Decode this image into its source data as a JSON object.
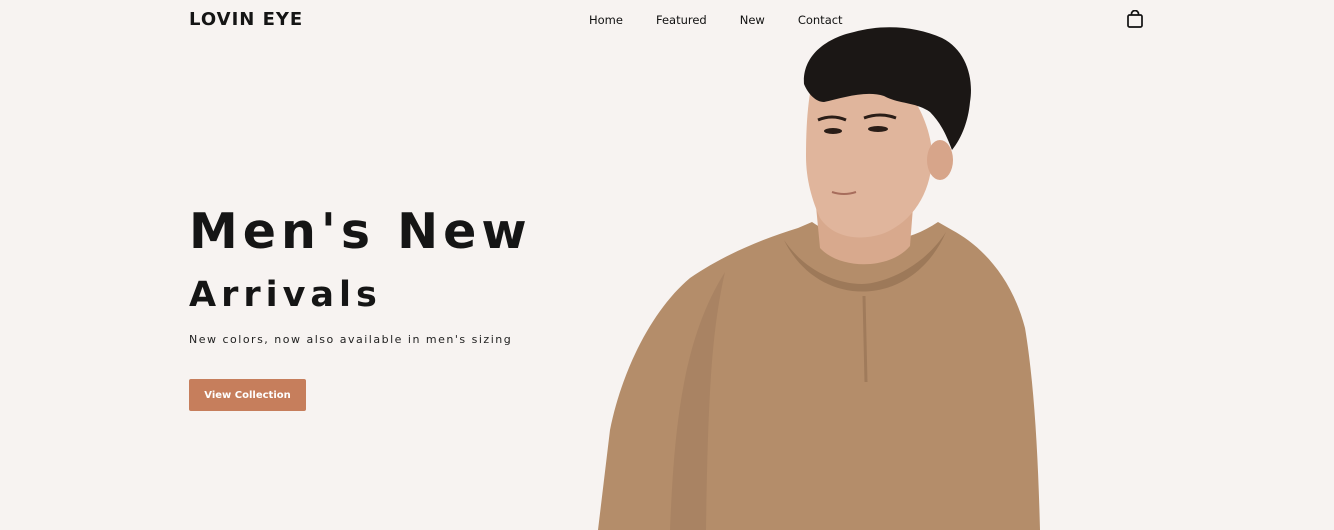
{
  "brand": {
    "name": "LOVIN EYE"
  },
  "nav": {
    "items": [
      "Home",
      "Featured",
      "New",
      "Contact"
    ]
  },
  "hero": {
    "title_line_1": "Men's New",
    "title_line_2": "Arrivals",
    "tagline": "New colors, now also available in men's sizing",
    "cta_label": "View Collection"
  },
  "colors": {
    "background": "#f7f3f1",
    "accent": "#c67e5c",
    "sweater": "#b48d6a",
    "hair": "#1b1715",
    "skin": "#e0b59c"
  },
  "icons": {
    "cart": "shopping-bag-icon"
  }
}
